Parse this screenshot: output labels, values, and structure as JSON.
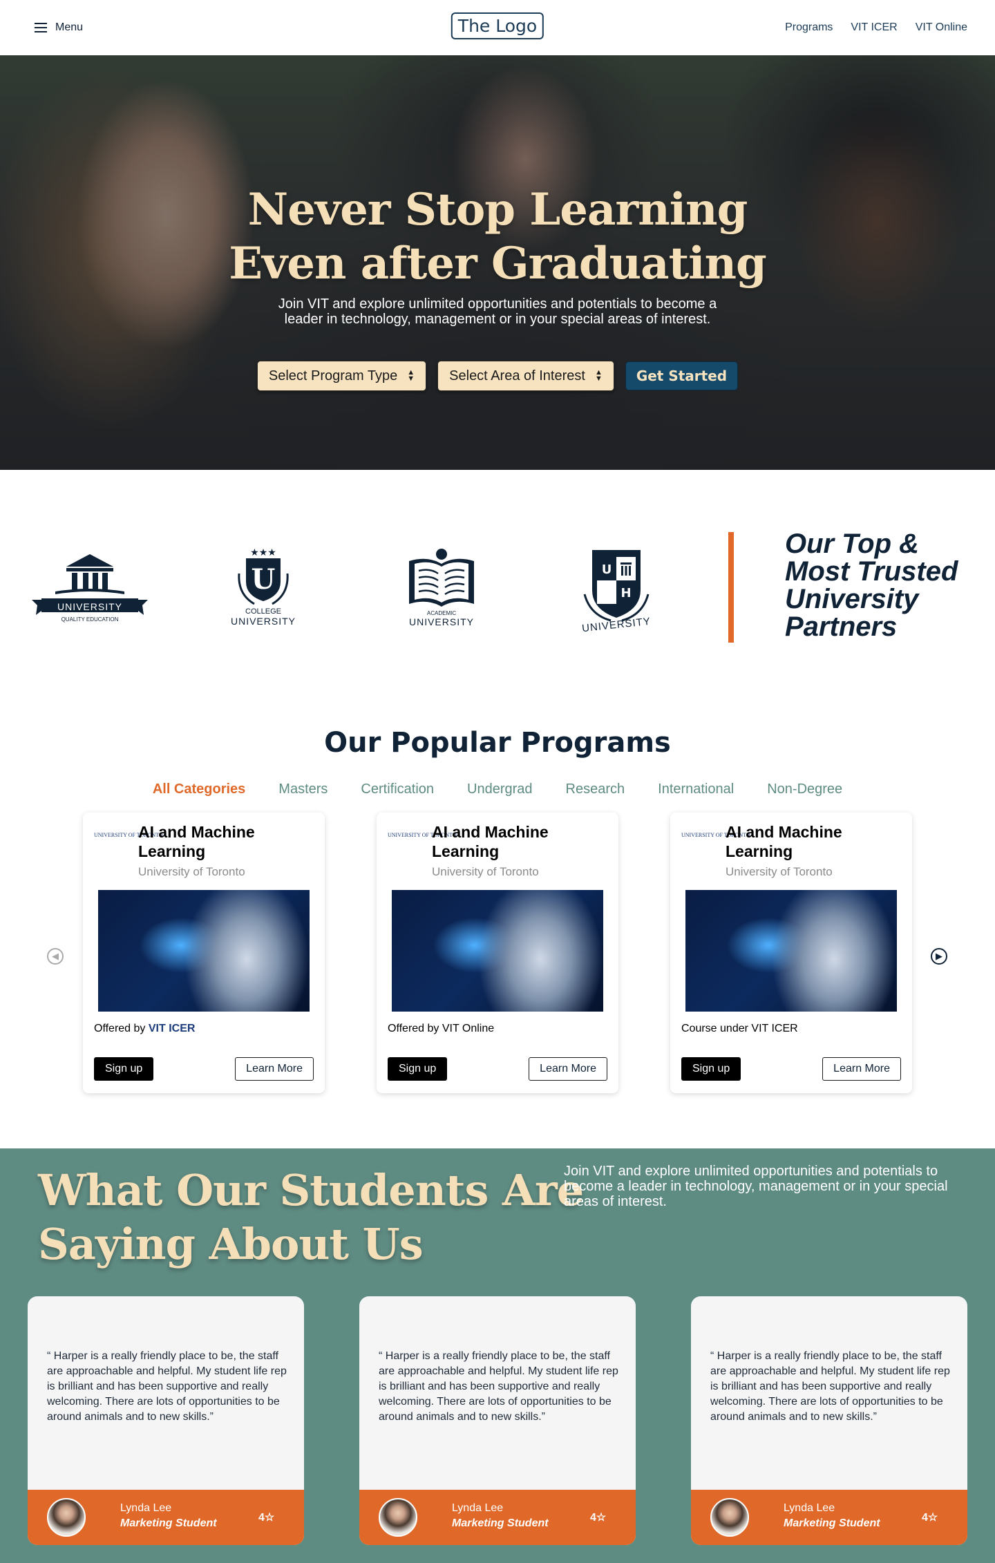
{
  "header": {
    "menu_label": "Menu",
    "logo_text": "The Logo",
    "nav": [
      "Programs",
      "VIT ICER",
      "VIT Online"
    ]
  },
  "hero": {
    "title_line1": "Never Stop Learning",
    "title_line2": "Even after Graduating",
    "subtitle": "Join VIT and explore unlimited opportunities and potentials to become a leader in technology, management or in your special areas of interest.",
    "select_program": "Select Program Type",
    "select_area": "Select Area of Interest",
    "cta": "Get Started"
  },
  "partners": {
    "logos": [
      {
        "name": "UNIVERSITY",
        "tagline": "QUALITY EDUCATION"
      },
      {
        "name": "UNIVERSITY",
        "tagline": "COLLEGE"
      },
      {
        "name": "UNIVERSITY",
        "tagline": "ACADEMIC"
      },
      {
        "name": "UNIVERSITY",
        "tagline": ""
      }
    ],
    "heading_lines": [
      "Our Top &",
      "Most Trusted",
      "University",
      "Partners"
    ]
  },
  "programs": {
    "title": "Our Popular Programs",
    "tabs": [
      "All Categories",
      "Masters",
      "Certification",
      "Undergrad",
      "Research",
      "International",
      "Non-Degree"
    ],
    "active_tab": "All Categories",
    "cards": [
      {
        "title": "AI and Machine Learning",
        "university": "University of Toronto",
        "offer_prefix": "Offered by ",
        "offer_highlight": "VIT ICER",
        "sign_up": "Sign up",
        "learn_more": "Learn More"
      },
      {
        "title": "AI and Machine Learning",
        "university": "University of Toronto",
        "offer_prefix": "Offered by VIT Online",
        "offer_highlight": "",
        "sign_up": "Sign up",
        "learn_more": "Learn More"
      },
      {
        "title": "AI and Machine Learning",
        "university": "University of Toronto",
        "offer_prefix": "Course under VIT ICER",
        "offer_highlight": "",
        "sign_up": "Sign up",
        "learn_more": "Learn More"
      }
    ],
    "uni_logo_text": "UNIVERSITY OF TORONTO"
  },
  "testimonials": {
    "title_line1": "What Our Students Are",
    "title_line2": "Saying About Us",
    "subtitle": "Join VIT and explore unlimited opportunities and potentials to become a leader in technology, management or in your special areas of interest.",
    "items": [
      {
        "quote": "“ Harper is a really friendly place to be, the staff are approachable and helpful. My student life rep is brilliant and has been supportive and really welcoming. There are lots of opportunities to be around animals and to new skills.”",
        "name": "Lynda Lee",
        "role": "Marketing Student",
        "rating": "4☆"
      },
      {
        "quote": "“ Harper is a really friendly place to be, the staff are approachable and helpful. My student life rep is brilliant and has been supportive and really welcoming. There are lots of opportunities to be around animals and to new skills.”",
        "name": "Lynda Lee",
        "role": "Marketing Student",
        "rating": "4☆"
      },
      {
        "quote": "“ Harper is a really friendly place to be, the staff are approachable and helpful. My student life rep is brilliant and has been supportive and really welcoming. There are lots of opportunities to be around animals and to new skills.”",
        "name": "Lynda Lee",
        "role": "Marketing Student",
        "rating": "4☆"
      }
    ]
  },
  "colors": {
    "accent_orange": "#e0692a",
    "navy": "#0f2236",
    "teal": "#5e8b82",
    "cream": "#f5dfb8",
    "button_blue": "#154a6b"
  },
  "icons": [
    "hamburger-icon",
    "chevron-up-down-icon",
    "arrow-left-circle-icon",
    "arrow-right-circle-icon"
  ]
}
